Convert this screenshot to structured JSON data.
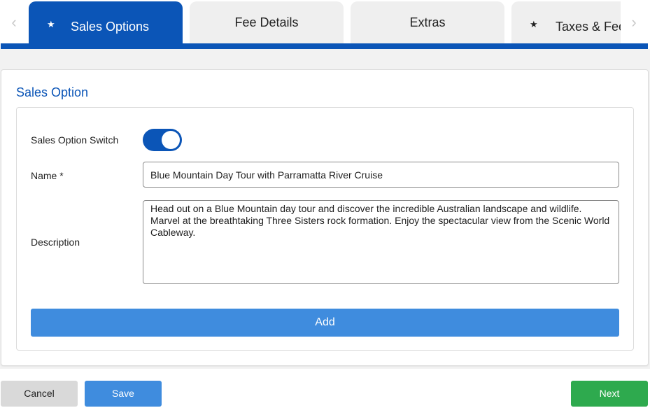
{
  "tabs": [
    {
      "label": "Sales Options",
      "active": true,
      "starred": true,
      "star": "★"
    },
    {
      "label": "Fee Details",
      "active": false,
      "starred": false
    },
    {
      "label": "Extras",
      "active": false,
      "starred": false
    },
    {
      "label": "Taxes & Fee",
      "active": false,
      "starred": true,
      "star": "★"
    }
  ],
  "nav": {
    "prev_icon": "chevron-left-icon",
    "next_icon": "chevron-right-icon",
    "prev_glyph": "‹",
    "next_glyph": "›"
  },
  "section": {
    "title": "Sales Option"
  },
  "form": {
    "switch_label": "Sales Option Switch",
    "switch_on": true,
    "name_label": "Name *",
    "name_value": "Blue Mountain Day Tour with Parramatta River Cruise",
    "description_label": "Description",
    "description_value": "Head out on a Blue Mountain day tour and discover the incredible Australian landscape and wildlife. Marvel at the breathtaking Three Sisters rock formation. Enjoy the spectacular view from the Scenic World Cableway.",
    "add_label": "Add"
  },
  "footer": {
    "cancel_label": "Cancel",
    "save_label": "Save",
    "next_label": "Next"
  },
  "colors": {
    "primary": "#0b55b7",
    "button_blue": "#3f8cde",
    "next_green": "#2eaa4e",
    "cancel_gray": "#d9d9d9"
  }
}
